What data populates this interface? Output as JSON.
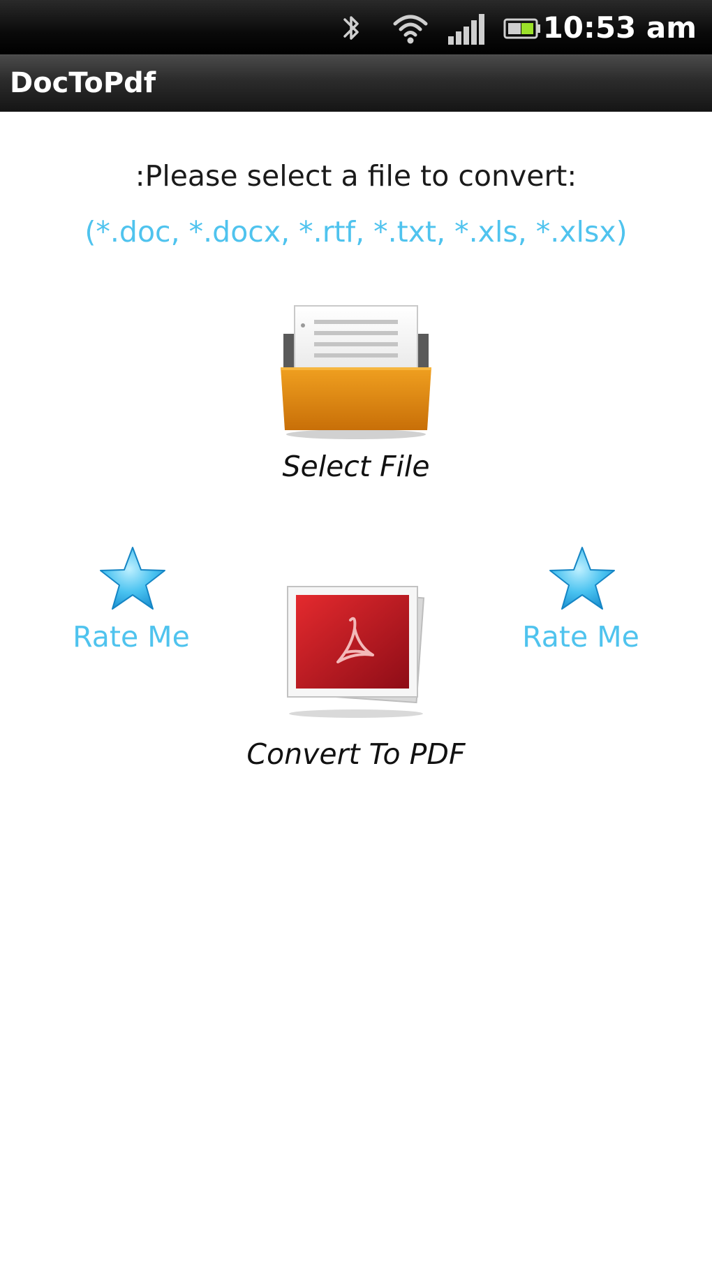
{
  "status_bar": {
    "time": "10:53 am",
    "icons": [
      "bluetooth-icon",
      "wifi-icon",
      "signal-icon",
      "battery-icon"
    ]
  },
  "title_bar": {
    "title": "DocToPdf"
  },
  "main": {
    "prompt": ":Please select a file to convert:",
    "extensions": "(*.doc, *.docx, *.rtf, *.txt, *.xls, *.xlsx)",
    "select_file": {
      "label": "Select File",
      "icon": "folder-icon"
    },
    "convert": {
      "label": "Convert To PDF",
      "icon": "pdf-icon"
    },
    "rate_left": {
      "label": "Rate Me",
      "icon": "star-icon"
    },
    "rate_right": {
      "label": "Rate Me",
      "icon": "star-icon"
    }
  },
  "colors": {
    "accent_blue": "#4fc3ee",
    "folder_orange": "#e08a12",
    "pdf_red": "#c8182a",
    "status_bar_bg": "#000000",
    "title_bar_bg": "#2b2b2b"
  }
}
